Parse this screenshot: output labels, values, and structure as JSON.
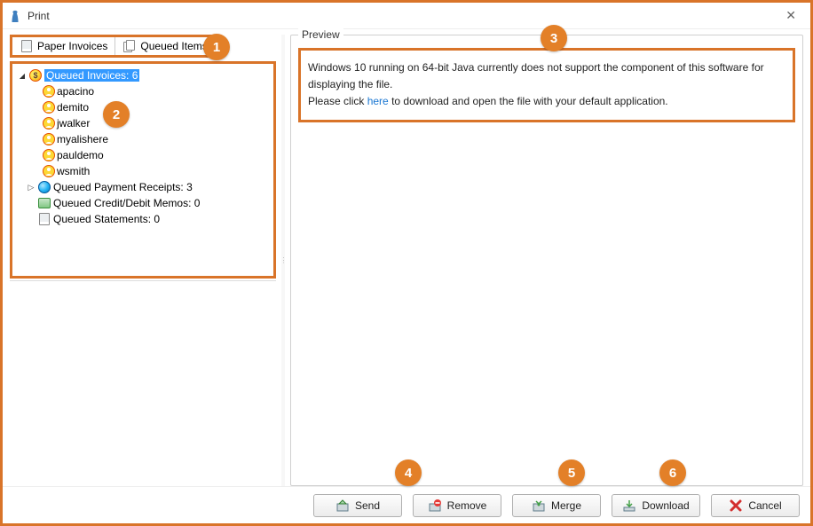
{
  "window": {
    "title": "Print"
  },
  "tabs": {
    "paper_invoices": "Paper Invoices",
    "queued_items": "Queued Items"
  },
  "tree": {
    "queued_invoices_label": "Queued Invoices: 6",
    "invoice_users": [
      {
        "name": "apacino"
      },
      {
        "name": "demito"
      },
      {
        "name": "jwalker"
      },
      {
        "name": "myalishere"
      },
      {
        "name": "pauldemo"
      },
      {
        "name": "wsmith"
      }
    ],
    "queued_payment_receipts": "Queued Payment Receipts: 3",
    "queued_credit_debit": "Queued Credit/Debit Memos: 0",
    "queued_statements": "Queued Statements: 0"
  },
  "preview": {
    "legend": "Preview",
    "line1": "Windows 10 running on 64-bit Java currently does not support the component of this software for displaying the file.",
    "line2a": "Please click ",
    "here_text": "here",
    "line2b": " to download and open the file with your default application."
  },
  "buttons": {
    "send": "Send",
    "remove": "Remove",
    "merge": "Merge",
    "download": "Download",
    "cancel": "Cancel"
  },
  "callouts": {
    "c1": "1",
    "c2": "2",
    "c3": "3",
    "c4": "4",
    "c5": "5",
    "c6": "6"
  }
}
